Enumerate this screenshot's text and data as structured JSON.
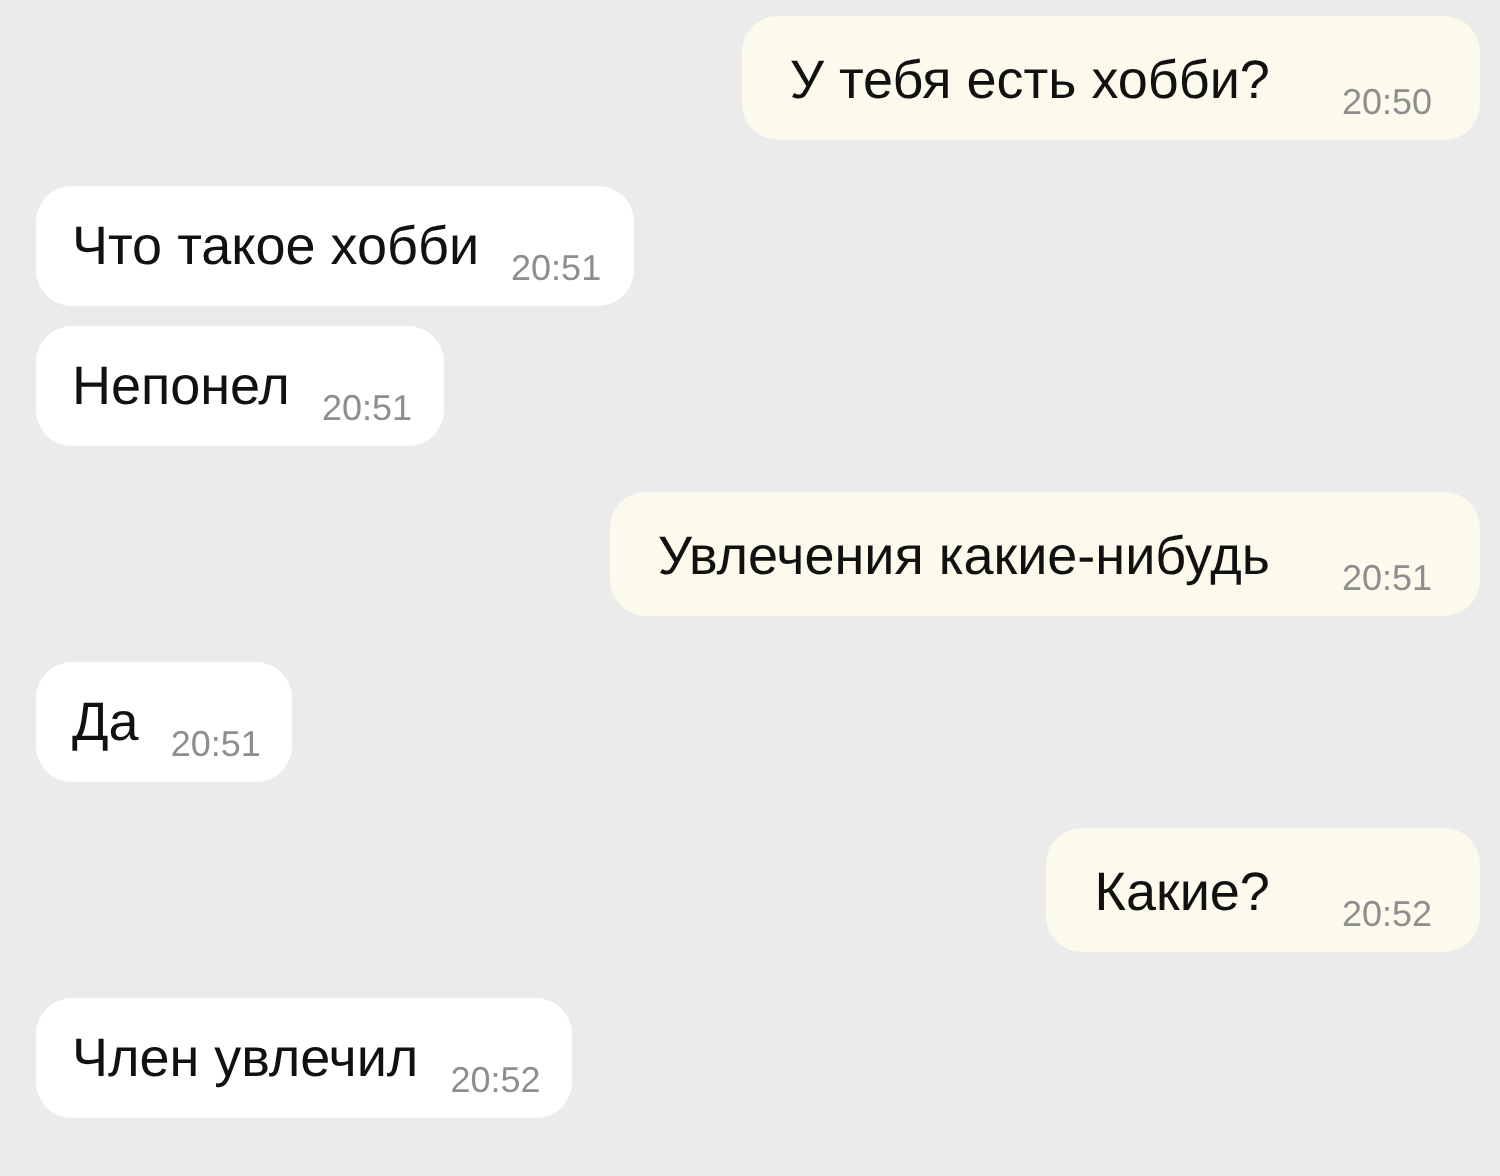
{
  "messages": [
    {
      "kind": "outgoing",
      "text": "У тебя есть хобби?",
      "time": "20:50"
    },
    {
      "kind": "incoming",
      "text": "Что такое хобби",
      "time": "20:51"
    },
    {
      "kind": "incoming",
      "text": "Непонел",
      "time": "20:51"
    },
    {
      "kind": "outgoing",
      "text": "Увлечения какие-нибудь",
      "time": "20:51"
    },
    {
      "kind": "incoming",
      "text": "Да",
      "time": "20:51"
    },
    {
      "kind": "outgoing",
      "text": "Какие?",
      "time": "20:52"
    },
    {
      "kind": "incoming",
      "text": "Член увлечил",
      "time": "20:52"
    }
  ]
}
